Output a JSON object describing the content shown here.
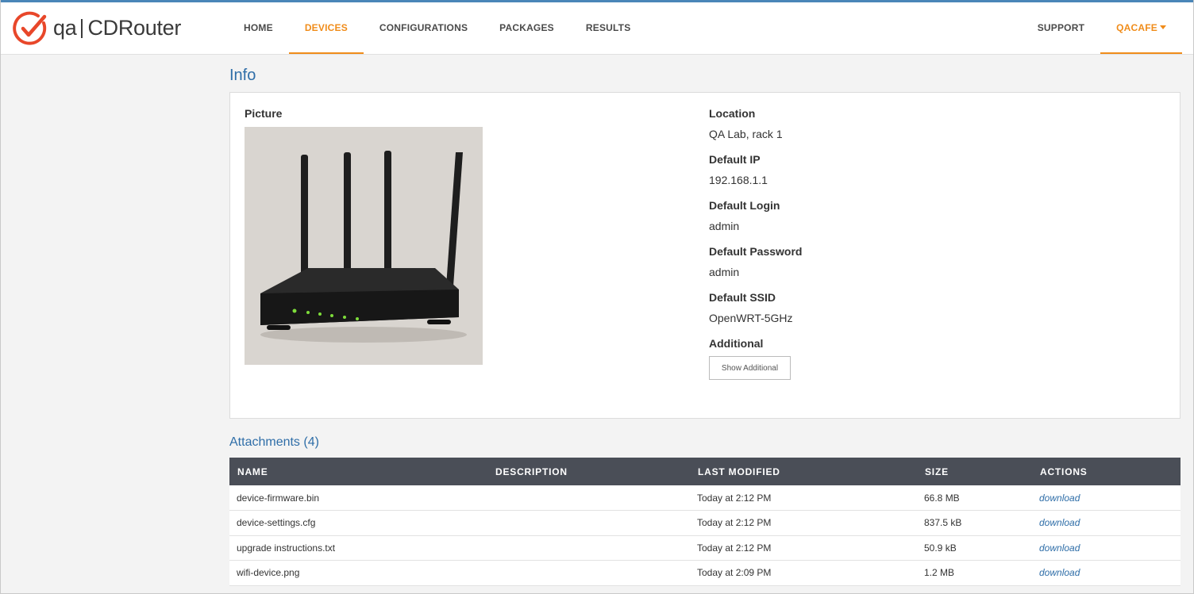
{
  "brand": {
    "prefix": "qa",
    "name": "CDRouter"
  },
  "nav": {
    "items": [
      {
        "label": "HOME",
        "active": false
      },
      {
        "label": "DEVICES",
        "active": true
      },
      {
        "label": "CONFIGURATIONS",
        "active": false
      },
      {
        "label": "PACKAGES",
        "active": false
      },
      {
        "label": "RESULTS",
        "active": false
      }
    ],
    "support": "SUPPORT",
    "user": "QACAFE"
  },
  "info": {
    "title": "Info",
    "picture_label": "Picture",
    "details": [
      {
        "label": "Location",
        "value": "QA Lab, rack 1"
      },
      {
        "label": "Default IP",
        "value": "192.168.1.1"
      },
      {
        "label": "Default Login",
        "value": "admin"
      },
      {
        "label": "Default Password",
        "value": "admin"
      },
      {
        "label": "Default SSID",
        "value": "OpenWRT-5GHz"
      }
    ],
    "additional_label": "Additional",
    "show_additional": "Show Additional"
  },
  "attachments": {
    "title": "Attachments (4)",
    "columns": [
      "NAME",
      "DESCRIPTION",
      "LAST MODIFIED",
      "SIZE",
      "ACTIONS"
    ],
    "rows": [
      {
        "name": "device-firmware.bin",
        "description": "",
        "modified": "Today at 2:12 PM",
        "size": "66.8 MB",
        "action": "download"
      },
      {
        "name": "device-settings.cfg",
        "description": "",
        "modified": "Today at 2:12 PM",
        "size": "837.5 kB",
        "action": "download"
      },
      {
        "name": "upgrade instructions.txt",
        "description": "",
        "modified": "Today at 2:12 PM",
        "size": "50.9 kB",
        "action": "download"
      },
      {
        "name": "wifi-device.png",
        "description": "",
        "modified": "Today at 2:09 PM",
        "size": "1.2 MB",
        "action": "download"
      }
    ]
  },
  "colors": {
    "accent": "#f08c1a",
    "link": "#2f6ea8",
    "table_header": "#4a4e57"
  }
}
